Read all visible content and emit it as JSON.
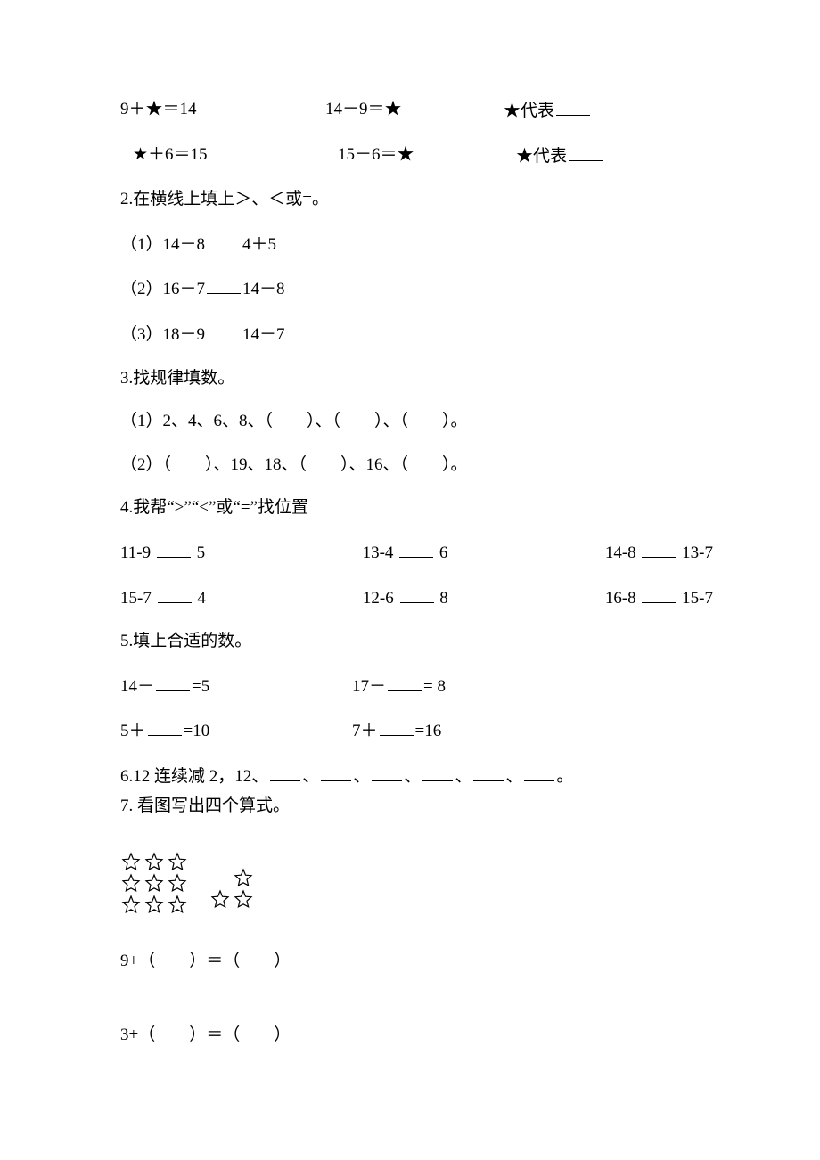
{
  "line1": {
    "a": "9＋★＝14",
    "b": "14－9＝★",
    "c_pre": "★代表"
  },
  "line2": {
    "a": "★＋6＝15",
    "b": "15－6＝★",
    "c_pre": "★代表"
  },
  "q2": {
    "title": "2.在横线上填上＞、＜或=。",
    "items": [
      {
        "left": "（1）14－8",
        "right": "4＋5"
      },
      {
        "left": "（2）16－7",
        "right": "14－8"
      },
      {
        "left": "（3）18－9",
        "right": "14－7"
      }
    ]
  },
  "q3": {
    "title": "3.找规律填数。",
    "items": [
      "（1）2、4、6、8、（　　）、（　　）、（　　）。",
      "（2）（　　）、19、18、（　　）、16、（　　）。"
    ]
  },
  "q4": {
    "title": "4.我帮“>”“<”或“=”找位置",
    "rows": [
      [
        {
          "l": "11-9",
          "r": "5"
        },
        {
          "l": "13-4",
          "r": "6"
        },
        {
          "l": "14-8",
          "r": "13-7"
        }
      ],
      [
        {
          "l": "15-7",
          "r": "4"
        },
        {
          "l": "12-6",
          "r": "8"
        },
        {
          "l": "16-8",
          "r": "15-7"
        }
      ]
    ]
  },
  "q5": {
    "title": "5.填上合适的数。",
    "rows": [
      [
        {
          "pre": "14－",
          "post": "=5"
        },
        {
          "pre": "17－",
          "post": "= 8"
        }
      ],
      [
        {
          "pre": "5＋",
          "post": "=10"
        },
        {
          "pre": "7＋",
          "post": "=16"
        }
      ]
    ]
  },
  "q6": {
    "text_a": "6.12 连续减 2，12、",
    "tail": "。"
  },
  "q7": {
    "title": "7. 看图写出四个算式。",
    "eq1": {
      "lhs": "9+（　　）＝（　　）"
    },
    "eq2": {
      "lhs": "3+（　　）＝（　　）"
    }
  }
}
